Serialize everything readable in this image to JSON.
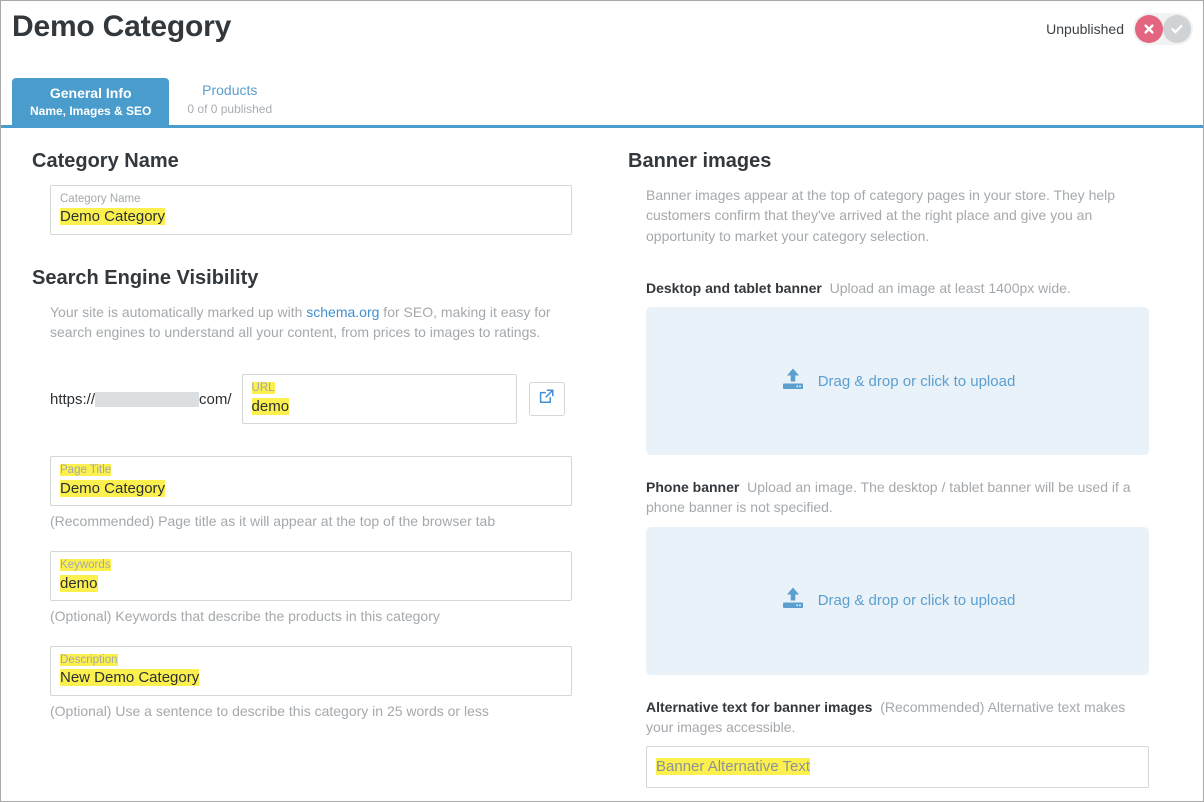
{
  "header": {
    "title": "Demo Category",
    "publish_status_label": "Unpublished",
    "toggle_off_icon": "close-circle-icon",
    "toggle_on_icon": "check-circle-icon"
  },
  "tabs": [
    {
      "label": "General Info",
      "sublabel": "Name, Images & SEO",
      "active": true
    },
    {
      "label": "Products",
      "sublabel": "0 of 0 published",
      "active": false
    }
  ],
  "left": {
    "category_name": {
      "section_title": "Category Name",
      "field_label": "Category Name",
      "field_value": "Demo Category"
    },
    "seo": {
      "section_title": "Search Engine Visibility",
      "description_before": "Your site is automatically marked up with ",
      "description_link": "schema.org",
      "description_after": " for SEO, making it easy for search engines to understand all your content, from prices to images to ratings.",
      "url_prefix": "https://",
      "url_suffix": "com/",
      "url_label": "URL",
      "url_value": "demo",
      "external_link_icon": "external-link-icon",
      "page_title_label": "Page Title",
      "page_title_value": "Demo Category",
      "page_title_help": "(Recommended) Page title as it will appear at the top of the browser tab",
      "keywords_label": "Keywords",
      "keywords_value": "demo",
      "keywords_help": "(Optional) Keywords that describe the products in this category",
      "description_label": "Description",
      "description_value": "New Demo Category",
      "description_help": "(Optional) Use a sentence to describe this category in 25 words or less"
    }
  },
  "right": {
    "section_title": "Banner images",
    "section_desc": "Banner images appear at the top of category pages in your store. They help customers confirm that they've arrived at the right place and give you an opportunity to market your category selection.",
    "desktop_banner_label": "Desktop and tablet banner",
    "desktop_banner_hint": "Upload an image at least 1400px wide.",
    "phone_banner_label": "Phone banner",
    "phone_banner_hint": "Upload an image. The desktop / tablet banner will be used if a phone banner is not specified.",
    "dropzone_text": "Drag & drop or click to upload",
    "dropzone_icon": "upload-icon",
    "alt_text_label": "Alternative text for banner images",
    "alt_text_hint": "(Recommended) Alternative text makes your images accessible.",
    "alt_text_placeholder": "Banner Alternative Text"
  },
  "colors": {
    "accent_blue": "#4a9ccd",
    "link_blue": "#3f8fd2",
    "highlight_yellow": "#fcf04f",
    "dropzone_blue": "#eaf2f9",
    "unpublished_red": "#e4657f",
    "toggle_gray": "#cfd3d6",
    "muted_text": "#a4a9ad",
    "heading_text": "#33383d"
  }
}
